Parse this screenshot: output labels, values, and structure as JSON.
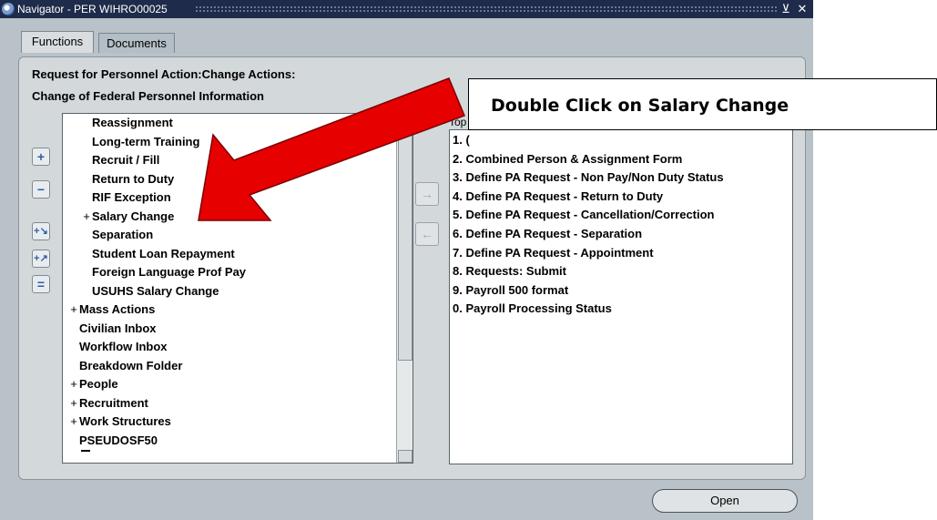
{
  "window": {
    "title": "Navigator - PER WIHRO00025",
    "buttons": {
      "minimize_glyph": "⊻",
      "close_glyph": "✕"
    }
  },
  "tabs": [
    {
      "label": "Functions",
      "active": true
    },
    {
      "label": "Documents",
      "active": false
    }
  ],
  "header": {
    "line1": "Request for Personnel Action:Change Actions:",
    "line2": "Change of Federal Personnel Information"
  },
  "functions_list": [
    {
      "label": "Reassignment",
      "expand": "",
      "indent": 1
    },
    {
      "label": "Long-term Training",
      "expand": "",
      "indent": 1
    },
    {
      "label": "Recruit / Fill",
      "expand": "",
      "indent": 1
    },
    {
      "label": "Return to Duty",
      "expand": "",
      "indent": 1
    },
    {
      "label": "RIF Exception",
      "expand": "",
      "indent": 1
    },
    {
      "label": "Salary Change",
      "expand": "+",
      "indent": 1
    },
    {
      "label": "Separation",
      "expand": "",
      "indent": 1
    },
    {
      "label": "Student Loan Repayment",
      "expand": "",
      "indent": 1
    },
    {
      "label": "Foreign Language Prof Pay",
      "expand": "",
      "indent": 1
    },
    {
      "label": "USUHS Salary Change",
      "expand": "",
      "indent": 1
    },
    {
      "label": "Mass Actions",
      "expand": "+",
      "indent": 0
    },
    {
      "label": "Civilian Inbox",
      "expand": "",
      "indent": 0
    },
    {
      "label": "Workflow Inbox",
      "expand": "",
      "indent": 0
    },
    {
      "label": "Breakdown Folder",
      "expand": "",
      "indent": 0
    },
    {
      "label": "People",
      "expand": "+",
      "indent": 0
    },
    {
      "label": "Recruitment",
      "expand": "+",
      "indent": 0
    },
    {
      "label": "Work Structures",
      "expand": "+",
      "indent": 0
    },
    {
      "label": "PSEUDOSF50",
      "expand": "",
      "indent": 0
    }
  ],
  "side_buttons": [
    {
      "name": "expand-button",
      "glyph": "+"
    },
    {
      "name": "collapse-button",
      "glyph": "−"
    },
    {
      "name": "expand-branch-button",
      "glyph": "+↘"
    },
    {
      "name": "expand-all-button",
      "glyph": "+↗"
    },
    {
      "name": "collapse-all-button",
      "glyph": "="
    }
  ],
  "top_ten": {
    "label": "Top",
    "items": [
      "1. (",
      "2. Combined Person & Assignment Form",
      "3. Define PA Request - Non Pay/Non Duty Status",
      "4. Define PA Request - Return to Duty",
      "5. Define PA Request - Cancellation/Correction",
      "6. Define PA Request - Separation",
      "7. Define PA Request - Appointment",
      "8. Requests: Submit",
      "9. Payroll 500 format",
      "0. Payroll Processing Status"
    ]
  },
  "mid_buttons": {
    "add_glyph": "→",
    "remove_glyph": "←"
  },
  "open_button": {
    "label": "Open"
  },
  "callout": {
    "text": "Double Click on Salary Change"
  },
  "colors": {
    "arrow_red": "#e60000",
    "titlebar": "#1e2b4a"
  }
}
